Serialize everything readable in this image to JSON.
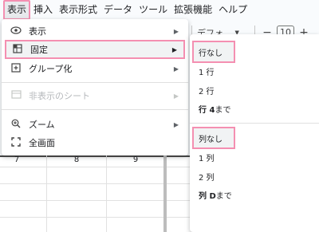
{
  "menubar": {
    "items": [
      "表示",
      "挿入",
      "表示形式",
      "データ",
      "ツール",
      "拡張機能",
      "ヘルプ"
    ]
  },
  "toolbar": {
    "font_name": "デフォ...",
    "font_size": "10",
    "minus": "−",
    "plus": "+"
  },
  "grid": {
    "cells": [
      "7",
      "8",
      "9"
    ]
  },
  "view_menu": {
    "items": [
      {
        "label": "表示",
        "icon": "eye-icon",
        "has_submenu": true
      },
      {
        "label": "固定",
        "icon": "freeze-grid-icon",
        "has_submenu": true
      },
      {
        "label": "グループ化",
        "icon": "group-plus-icon",
        "has_submenu": true
      },
      {
        "label": "非表示のシート",
        "icon": "hidden-sheet-icon",
        "has_submenu": true,
        "disabled": true
      },
      {
        "label": "ズーム",
        "icon": "zoom-icon",
        "has_submenu": true
      },
      {
        "label": "全画面",
        "icon": "fullscreen-icon",
        "has_submenu": false
      }
    ]
  },
  "freeze_submenu": {
    "rows": [
      "行なし",
      "1 行",
      "2 行"
    ],
    "rows_current": {
      "prefix": "行 4",
      "suffix": " まで"
    },
    "cols": [
      "列なし",
      "1 列",
      "2 列"
    ],
    "cols_current": {
      "prefix": "列 D",
      "suffix": " まで"
    }
  },
  "colors": {
    "highlight_border": "#f48fb1",
    "menu_bg": "#ffffff",
    "page_bg": "#f9fbfd"
  }
}
